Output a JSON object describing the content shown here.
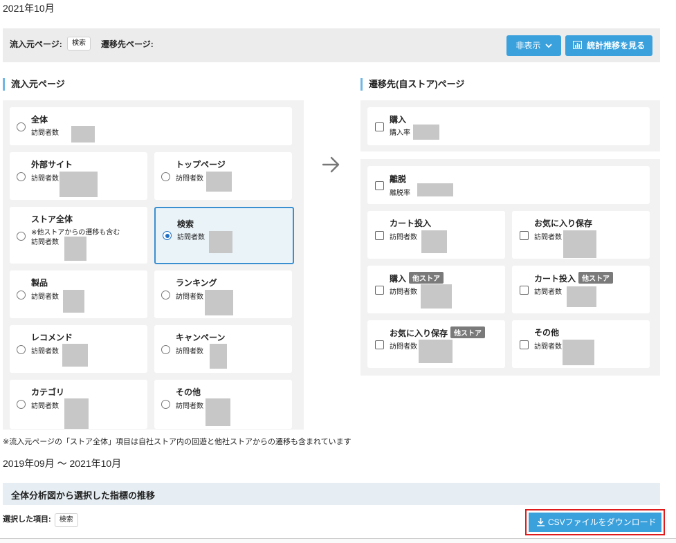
{
  "header": {
    "month": "2021年10月"
  },
  "filter": {
    "source_label": "流入元ページ:",
    "source_tag": "検索",
    "dest_label": "遷移先ページ:",
    "hide_button": "非表示",
    "stats_button": "統計推移を見る"
  },
  "source_panel": {
    "title": "流入元ページ",
    "items": [
      {
        "label": "全体",
        "sub": "訪問者数",
        "selected": false
      },
      {
        "label": "外部サイト",
        "sub": "訪問者数",
        "selected": false
      },
      {
        "label": "トップページ",
        "sub": "訪問者数",
        "selected": false
      },
      {
        "label": "ストア全体",
        "note": "※他ストアからの遷移も含む",
        "sub": "訪問者数",
        "selected": false
      },
      {
        "label": "検索",
        "sub": "訪問者数",
        "selected": true
      },
      {
        "label": "製品",
        "sub": "訪問者数",
        "selected": false
      },
      {
        "label": "ランキング",
        "sub": "訪問者数",
        "selected": false
      },
      {
        "label": "レコメンド",
        "sub": "訪問者数",
        "selected": false
      },
      {
        "label": "キャンペーン",
        "sub": "訪問者数",
        "selected": false
      },
      {
        "label": "カテゴリ",
        "sub": "訪問者数",
        "selected": false
      },
      {
        "label": "その他",
        "sub": "訪問者数",
        "selected": false
      }
    ]
  },
  "dest_panel": {
    "title": "遷移先(自ストア)ページ",
    "badge": "他ストア",
    "items": [
      {
        "label": "購入",
        "sub": "購入率"
      },
      {
        "label": "離脱",
        "sub": "離脱率"
      },
      {
        "label": "カート投入",
        "sub": "訪問者数"
      },
      {
        "label": "お気に入り保存",
        "sub": "訪問者数"
      },
      {
        "label": "購入",
        "sub": "訪問者数",
        "other_store": true
      },
      {
        "label": "カート投入",
        "sub": "訪問者数",
        "other_store": true
      },
      {
        "label": "お気に入り保存",
        "sub": "訪問者数",
        "other_store": true
      },
      {
        "label": "その他",
        "sub": "訪問者数"
      }
    ]
  },
  "footnote": "※流入元ページの「ストア全体」項目は自社ストア内の回遊と他社ストアからの遷移も含まれています",
  "range": "2019年09月 〜 2021年10月",
  "trend_section": {
    "title": "全体分析図から選択した指標の推移",
    "selected_label": "選択した項目:",
    "selected_tag": "検索",
    "csv_button": "CSVファイルをダウンロード"
  },
  "icons": [
    "chevron-down-icon",
    "bar-chart-icon",
    "arrow-right-icon",
    "download-icon"
  ],
  "colors": {
    "accent": "#3aa1dd",
    "selected_border": "#3a8fd0",
    "highlight": "#e01b1b"
  }
}
